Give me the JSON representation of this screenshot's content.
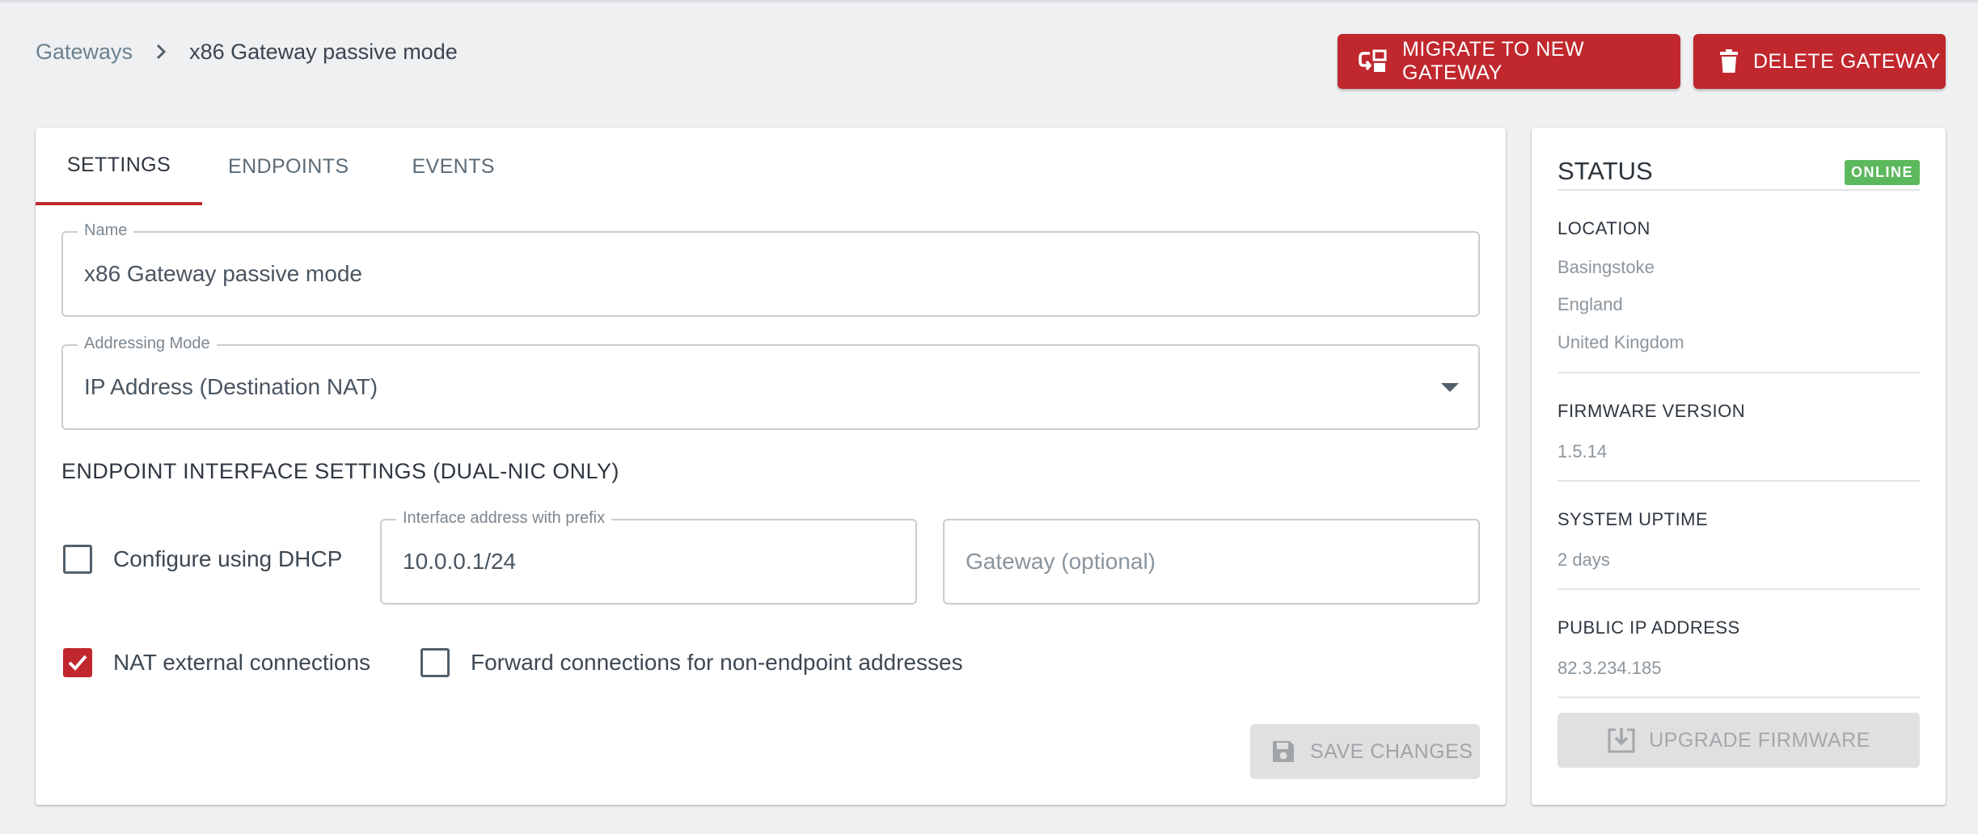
{
  "breadcrumb": {
    "parent": "Gateways",
    "current": "x86 Gateway passive mode"
  },
  "actions": {
    "migrate_label": "MIGRATE TO NEW GATEWAY",
    "delete_label": "DELETE GATEWAY"
  },
  "tabs": [
    {
      "label": "SETTINGS",
      "active": true
    },
    {
      "label": "ENDPOINTS",
      "active": false
    },
    {
      "label": "EVENTS",
      "active": false
    }
  ],
  "form": {
    "name_label": "Name",
    "name_value": "x86 Gateway passive mode",
    "mode_label": "Addressing Mode",
    "mode_value": "IP Address (Destination NAT)",
    "endpoint_section_title": "ENDPOINT INTERFACE SETTINGS (DUAL-NIC ONLY)",
    "dhcp_label": "Configure using DHCP",
    "dhcp_checked": false,
    "iface_label": "Interface address with prefix",
    "iface_value": "10.0.0.1/24",
    "gateway_placeholder": "Gateway (optional)",
    "nat_label": "NAT external connections",
    "nat_checked": true,
    "forward_label": "Forward connections for non-endpoint addresses",
    "forward_checked": false,
    "save_label": "SAVE CHANGES"
  },
  "status": {
    "title": "STATUS",
    "badge": "ONLINE",
    "location_label": "LOCATION",
    "location_lines": [
      "Basingstoke",
      "England",
      "United Kingdom"
    ],
    "firmware_label": "FIRMWARE VERSION",
    "firmware_value": "1.5.14",
    "uptime_label": "SYSTEM UPTIME",
    "uptime_value": "2 days",
    "public_ip_label": "PUBLIC IP ADDRESS",
    "public_ip_value": "82.3.234.185",
    "upgrade_label": "UPGRADE FIRMWARE"
  },
  "colors": {
    "accent": "#c0282e",
    "online": "#5cb85c",
    "background": "#eff0f2"
  }
}
